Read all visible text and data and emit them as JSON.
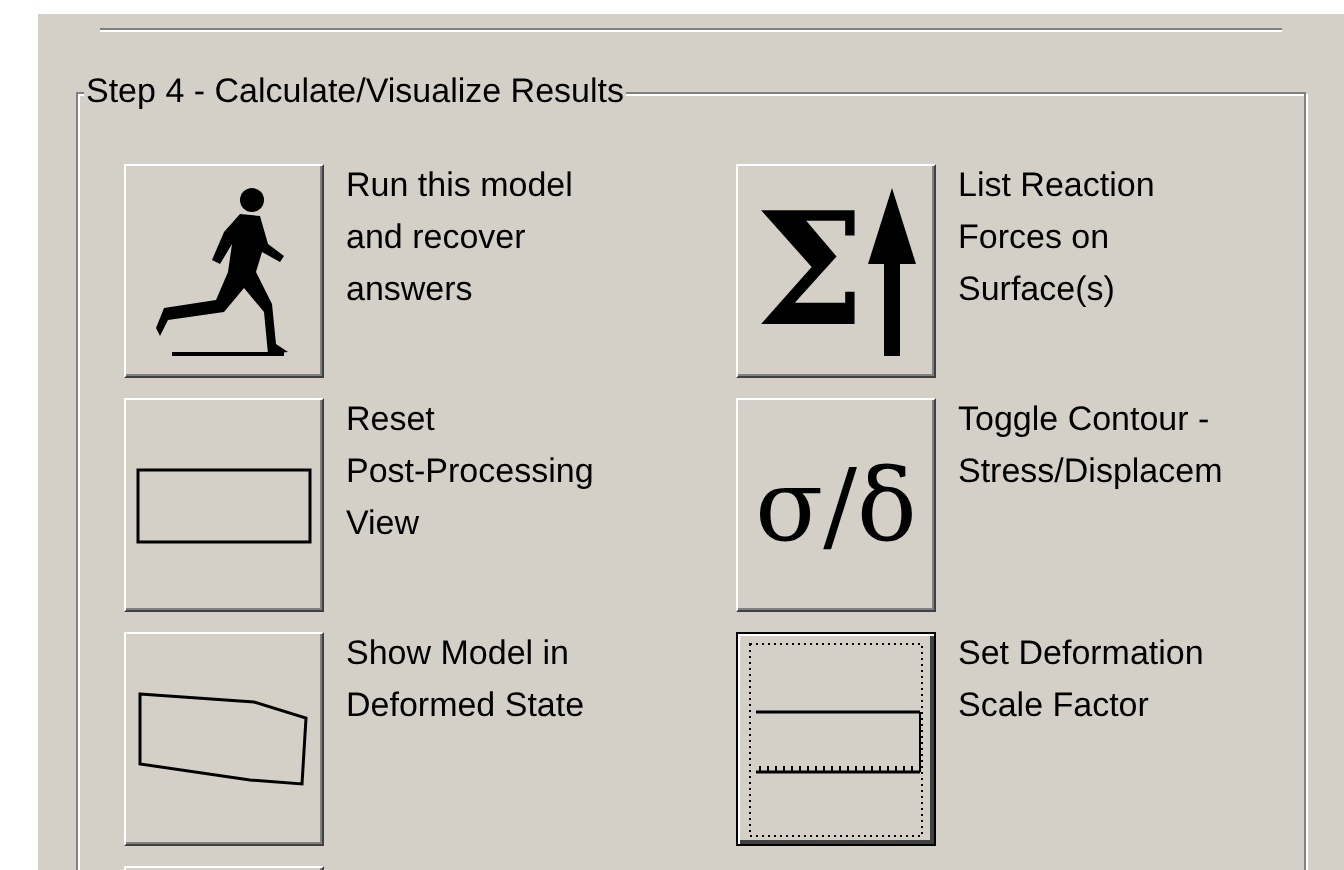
{
  "group": {
    "title": "Step 4 - Calculate/Visualize Results"
  },
  "actions": [
    {
      "kind": "runner",
      "label": "Run this model\nand recover\nanswers",
      "focused": false
    },
    {
      "kind": "sigma",
      "glyph": "Σ",
      "label": "List Reaction\nForces on\nSurface(s)",
      "focused": false
    },
    {
      "kind": "rectangle",
      "label": "Reset\nPost-Processing\nView",
      "focused": false
    },
    {
      "kind": "glyph",
      "glyph": "σ/δ",
      "label": "Toggle Contour -\nStress/Displacem",
      "focused": false
    },
    {
      "kind": "skewed",
      "label": "Show Model in\nDeformed State",
      "focused": false
    },
    {
      "kind": "scale",
      "label": "Set Deformation\nScale Factor",
      "focused": true
    },
    {
      "kind": "blank",
      "focused": false
    }
  ]
}
